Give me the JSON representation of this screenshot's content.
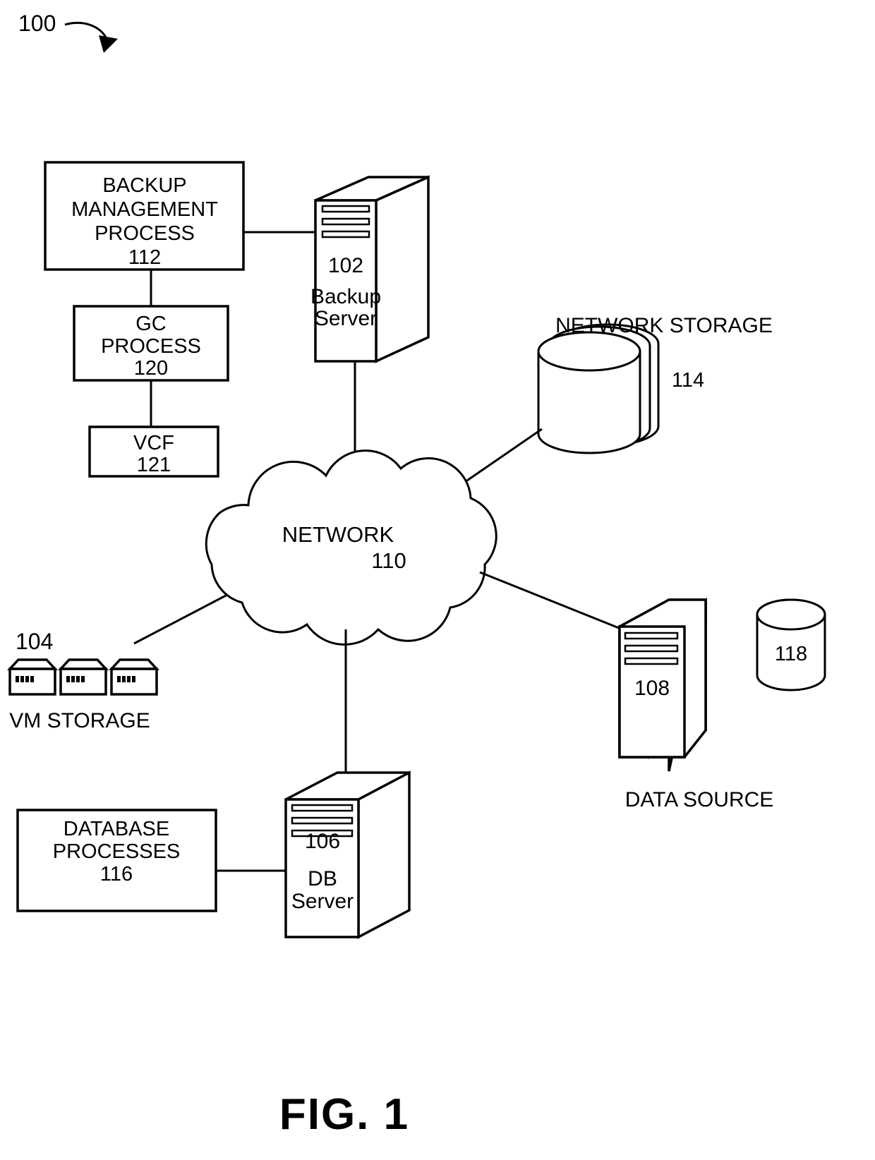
{
  "figure": {
    "caption": "FIG.  1",
    "system_ref": "100"
  },
  "nodes": {
    "backup_management_process": {
      "line1": "BACKUP",
      "line2": "MANAGEMENT",
      "line3": "PROCESS",
      "ref": "112"
    },
    "gc_process": {
      "line1": "GC",
      "line2": "PROCESS",
      "ref": "120"
    },
    "vcf": {
      "line1": "VCF",
      "ref": "121"
    },
    "backup_server": {
      "ref": "102",
      "line1": "Backup",
      "line2": "Server"
    },
    "network_storage": {
      "label": "NETWORK STORAGE",
      "ref": "114"
    },
    "network_cloud": {
      "label": "NETWORK",
      "ref": "110"
    },
    "vm_storage": {
      "ref": "104",
      "label": "VM STORAGE"
    },
    "data_source_server": {
      "ref": "108",
      "label": "DATA SOURCE"
    },
    "data_source_disk": {
      "ref": "118"
    },
    "db_server": {
      "ref": "106",
      "line1": "DB",
      "line2": "Server"
    },
    "database_processes": {
      "line1": "DATABASE",
      "line2": "PROCESSES",
      "ref": "116"
    }
  },
  "colors": {
    "stroke": "#000000",
    "background": "#ffffff"
  }
}
